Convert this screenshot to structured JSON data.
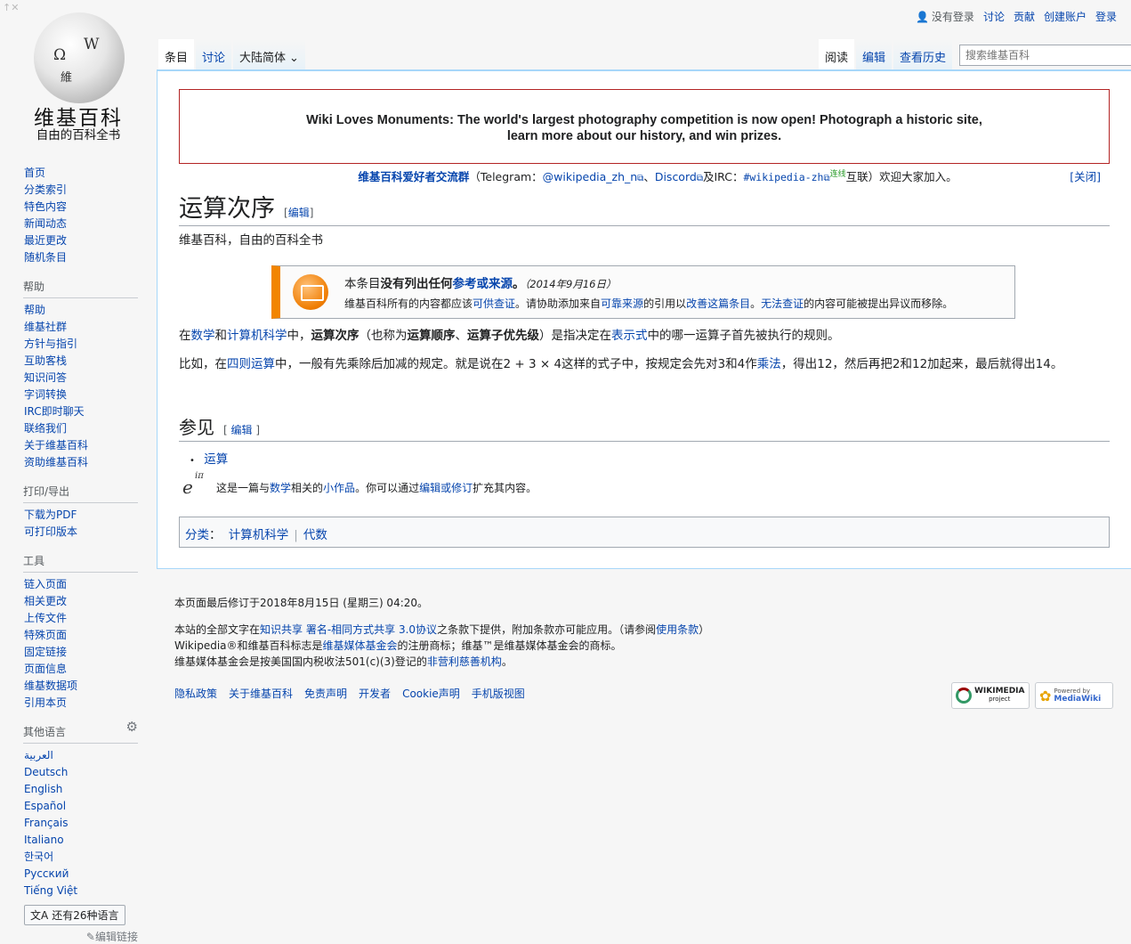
{
  "logo": {
    "wordmark": "维基百科",
    "tagline": "自由的百科全书",
    "globe_glyphs": [
      "Ω",
      "W",
      "維"
    ]
  },
  "personal": {
    "user_status": "没有登录",
    "links": [
      "讨论",
      "贡献",
      "创建账户",
      "登录"
    ]
  },
  "tabs": {
    "left": [
      "条目",
      "讨论"
    ],
    "variant": "大陆简体",
    "right": [
      "阅读",
      "编辑",
      "查看历史"
    ]
  },
  "search": {
    "placeholder": "搜索维基百科"
  },
  "sidebar": {
    "main": [
      "首页",
      "分类索引",
      "特色内容",
      "新闻动态",
      "最近更改",
      "随机条目"
    ],
    "help_title": "帮助",
    "help": [
      "帮助",
      "维基社群",
      "方针与指引",
      "互助客栈",
      "知识问答",
      "字词转换",
      "IRC即时聊天",
      "联络我们",
      "关于维基百科",
      "资助维基百科"
    ],
    "print_title": "打印/导出",
    "print": [
      "下载为PDF",
      "可打印版本"
    ],
    "tools_title": "工具",
    "tools": [
      "链入页面",
      "相关更改",
      "上传文件",
      "特殊页面",
      "固定链接",
      "页面信息",
      "维基数据项",
      "引用本页"
    ],
    "lang_title": "其他语言",
    "languages": [
      "العربية",
      "Deutsch",
      "English",
      "Español",
      "Français",
      "Italiano",
      "한국어",
      "Русский",
      "Tiếng Việt"
    ],
    "more_languages": "还有26种语言",
    "edit_links": "编辑链接"
  },
  "sitenotice": {
    "line1": "Wiki Loves Monuments: The world's largest photography competition is now open! Photograph a historic site,",
    "line2": "learn more about our history, and win prizes."
  },
  "telegram": {
    "group": "维基百科爱好者交流群",
    "open": "（Telegram：",
    "tg": "@wikipedia_zh_n",
    "sep1": "、",
    "discord": "Discord",
    "and": "及IRC：",
    "irc": "#wikipedia-zh",
    "connect": "连线",
    "rest": "互联）欢迎大家加入。",
    "close": "[关闭]"
  },
  "article": {
    "title": "运算次序",
    "edit": "编辑",
    "tagline": "维基百科，自由的百科全书",
    "ambox": {
      "pre": "本条目",
      "bold": "没有列出任何",
      "link": "参考或来源",
      "end": "。",
      "date": "（2014年9月16日）",
      "l2a": "维基百科所有的内容都应该",
      "l2b": "可供查证",
      "l2c": "。请协助添加来自",
      "l2d": "可靠来源",
      "l2e": "的引用以",
      "l2f": "改善这篇条目",
      "l2g": "。",
      "l2h": "无法查证",
      "l2i": "的内容可能被提出异议而移除。"
    },
    "p1": {
      "a": "在",
      "math": "数学",
      "and": "和",
      "cs": "计算机科学",
      "b": "中，",
      "term": "运算次序",
      "c": "（也称为",
      "t2": "运算顺序",
      "d": "、",
      "t3": "运算子优先级",
      "e": "）是指决定在",
      "expr": "表示式",
      "f": "中的哪一运算子首先被执行的规则。"
    },
    "p2": {
      "a": "比如，在",
      "arith": "四则运算",
      "b": "中，一般有先乘除后加减的规定。就是说在2 + 3 × 4这样的式子中，按规定会先对3和4作",
      "mul": "乘法",
      "c": "，得出12，然后再把2和12加起来，最后就得出14。"
    },
    "see_also_title": "参见",
    "see_also_edit": "编辑",
    "see_also": [
      "运算"
    ],
    "stub": {
      "a": "这是一篇与",
      "math": "数学",
      "b": "相关的",
      "small": "小作品",
      "c": "。你可以通过",
      "edit": "编辑或修订",
      "d": "扩充其内容。"
    },
    "categories_label": "分类",
    "categories": [
      "计算机科学",
      "代数"
    ]
  },
  "footer": {
    "lastmod": "本页面最后修订于2018年8月15日 (星期三) 04:20。",
    "l1a": "本站的全部文字在",
    "l1b": "知识共享 署名-相同方式共享 3.0协议",
    "l1c": "之条款下提供，附加条款亦可能应用。（请参阅",
    "l1d": "使用条款",
    "l1e": "）",
    "l2a": "Wikipedia®和维基百科标志是",
    "l2b": "维基媒体基金会",
    "l2c": "的注册商标；维基™是维基媒体基金会的商标。",
    "l3a": "维基媒体基金会是按美国国内税收法501(c)(3)登记的",
    "l3b": "非营利慈善机构",
    "l3c": "。",
    "links": [
      "隐私政策",
      "关于维基百科",
      "免责声明",
      "开发者",
      "Cookie声明",
      "手机版视图"
    ],
    "badge1": "WIKIMEDIA",
    "badge1sub": "project",
    "badge2": "MediaWiki",
    "badge2sub": "Powered by"
  },
  "colors": {
    "link": "#0645ad",
    "notice_border": "#b32424",
    "ambox_stripe": "#f28500"
  }
}
